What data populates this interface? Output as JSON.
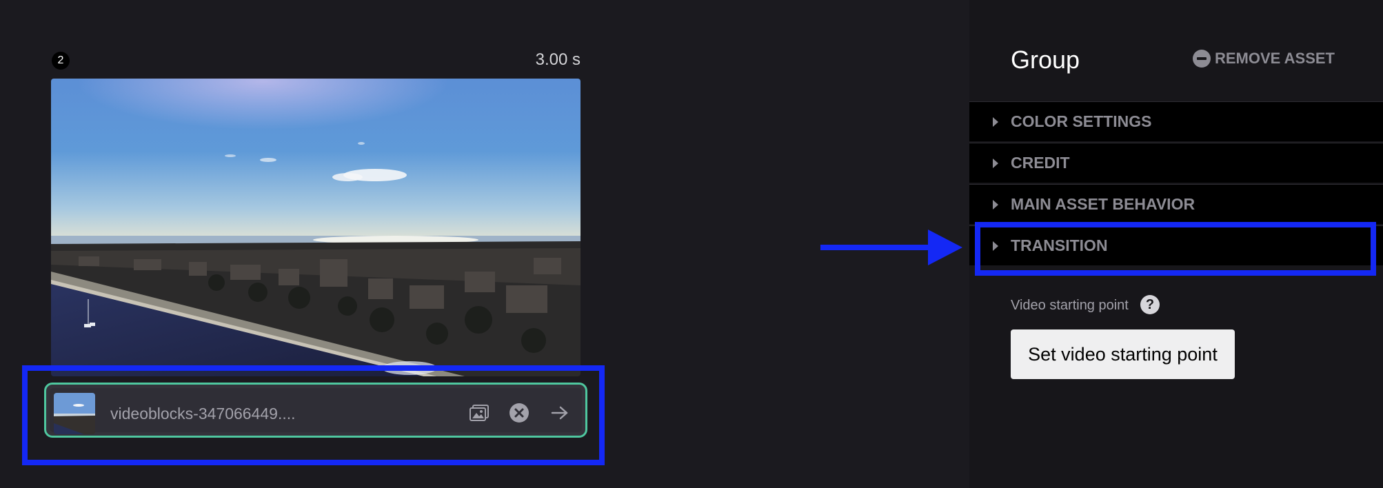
{
  "preview": {
    "scene_number": "2",
    "duration": "3.00 s"
  },
  "asset": {
    "filename": "videoblocks-347066449...."
  },
  "panel": {
    "title": "Group",
    "remove_label": "REMOVE ASSET",
    "sections": [
      {
        "label": "COLOR SETTINGS"
      },
      {
        "label": "CREDIT"
      },
      {
        "label": "MAIN ASSET BEHAVIOR"
      },
      {
        "label": "TRANSITION"
      }
    ],
    "video_starting_point_label": "Video starting point",
    "help_glyph": "?",
    "set_start_button": "Set video starting point"
  },
  "icons": {
    "image": "image-icon",
    "remove": "close-circle-icon",
    "next": "arrow-right-icon",
    "help": "help-icon",
    "minus": "minus-circle-icon"
  },
  "colors": {
    "highlight": "#1428f5",
    "asset_border": "#4fc79f",
    "background": "#1b1a1f",
    "panel": "#17161a"
  }
}
